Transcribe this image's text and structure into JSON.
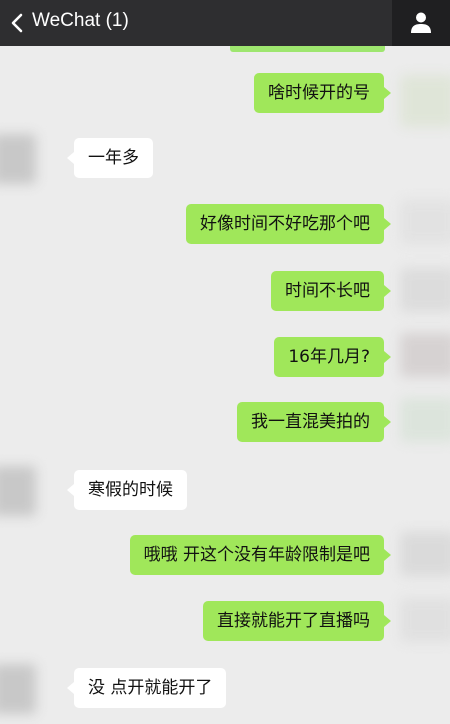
{
  "header": {
    "title": "WeChat (1)"
  },
  "messages": [
    {
      "side": "out",
      "text": "啥时候开的号"
    },
    {
      "side": "in",
      "text": "一年多"
    },
    {
      "side": "out",
      "text": "好像时间不好吃那个吧"
    },
    {
      "side": "out",
      "text": "时间不长吧"
    },
    {
      "side": "out",
      "text": "16年几月?"
    },
    {
      "side": "out",
      "text": "我一直混美拍的"
    },
    {
      "side": "in",
      "text": "寒假的时候"
    },
    {
      "side": "out",
      "text": "哦哦 开这个没有年龄限制是吧"
    },
    {
      "side": "out",
      "text": "直接就能开了直播吗"
    },
    {
      "side": "in",
      "text": "没 点开就能开了"
    }
  ],
  "colors": {
    "header_bg": "#2e2e30",
    "chat_bg": "#ececec",
    "outgoing_bubble": "#a0e75a",
    "incoming_bubble": "#ffffff"
  },
  "icons": [
    "back-chevron-icon",
    "contact-person-icon"
  ]
}
